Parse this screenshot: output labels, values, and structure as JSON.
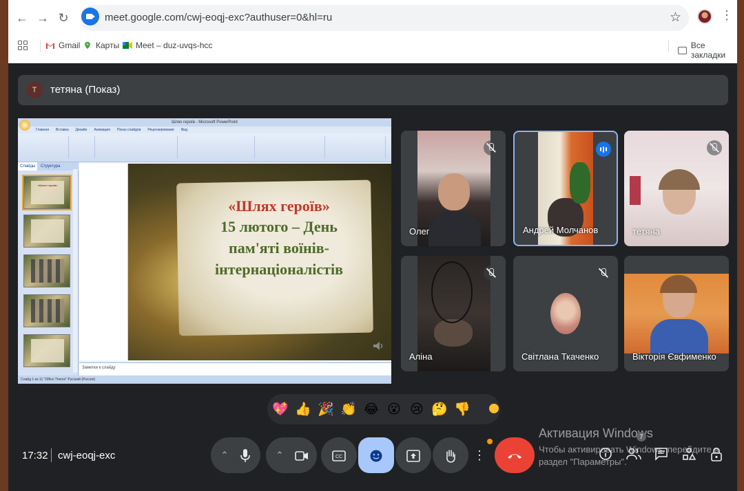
{
  "browser": {
    "url": "meet.google.com/cwj-eoqj-exc?authuser=0&hl=ru",
    "bookmarks": [
      "Gmail",
      "Карты",
      "Meet – duz-uvqs-hcc"
    ],
    "all_bookmarks_label": "Все закладки"
  },
  "presenter": {
    "initial": "Т",
    "label": "тетяна (Показ)"
  },
  "presentation": {
    "window_title": "Шлях героїв - Microsoft PowerPoint",
    "ribbon_tabs": [
      "Главная",
      "Вставка",
      "Дизайн",
      "Анимация",
      "Показ слайдов",
      "Рецензирование",
      "Вид"
    ],
    "left_tabs": [
      "Слайды",
      "Структура"
    ],
    "slide_title": "«Шлях героїв»",
    "slide_body": "15 лютого – День\nпам'яті воїнів-\nінтернаціоналістів",
    "notes_placeholder": "Заметки к слайду",
    "status_text": "Слайд 1 из 11   \"Office Theme\"   Русский (Россия)"
  },
  "participants": [
    {
      "name": "Олег",
      "muted": true
    },
    {
      "name": "Андрей Молчанов",
      "muted": false,
      "speaking": true
    },
    {
      "name": "тетяна",
      "muted": true
    },
    {
      "name": "Аліна",
      "muted": true
    },
    {
      "name": "Світлана Ткаченко",
      "muted": true
    },
    {
      "name": "Вікторія Євфименко",
      "muted": false
    }
  ],
  "reactions": [
    "💖",
    "👍",
    "🎉",
    "👏",
    "😂",
    "😮",
    "😢",
    "🤔",
    "👎"
  ],
  "meeting": {
    "time": "17:32",
    "code": "cwj-eoqj-exc",
    "people_count": "7"
  },
  "watermark": {
    "title": "Активация Windows",
    "line1": "Чтобы активировать Windows, перейдите в",
    "line2": "раздел \"Параметры\"."
  },
  "colors": {
    "meet_bg": "#202124",
    "tile_bg": "#3c4043",
    "active_speaker_border": "#8ab4f8",
    "end_call": "#ea4335",
    "reaction_active": "#a8c7fa"
  }
}
